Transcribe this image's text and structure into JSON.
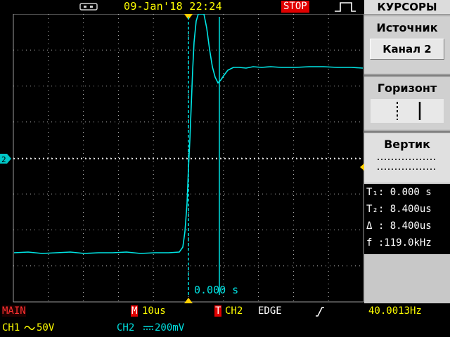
{
  "header": {
    "datetime": "09-Jan'18 22:24",
    "run_state": "STOP",
    "icons": {
      "usb": "usb-icon",
      "trigger_type": "rising-pulse-icon"
    }
  },
  "menu": {
    "title": "КУРСОРЫ",
    "items": [
      {
        "label": "Источник",
        "value": "Канал 2"
      },
      {
        "label": "Горизонт",
        "value": ""
      },
      {
        "label": "Вертик",
        "value": ""
      }
    ]
  },
  "readouts": {
    "t1": "T₁: 0.000 s",
    "t2": "T₂: 8.400us",
    "delta": "Δ : 8.400us",
    "freq": "f :119.0kHz"
  },
  "cursor_time": "0.000 s",
  "channel_marker": "2",
  "status": {
    "main": "MAIN",
    "timebase_prefix": "M",
    "timebase": "10us",
    "trigger_prefix": "T",
    "trigger_source": "CH2",
    "trigger_mode": "EDGE",
    "trigger_frequency": "40.0013Hz",
    "ch1_label": "CH1",
    "ch1_scale": "50V",
    "ch2_label": "CH2",
    "ch2_scale": "200mV"
  },
  "colors": {
    "trace": "#00e6e6",
    "grid": "#b0b0b0",
    "accent_yellow": "#ffff00",
    "stop_red": "#e00000",
    "menu_gray": "#c8c8c8"
  }
}
